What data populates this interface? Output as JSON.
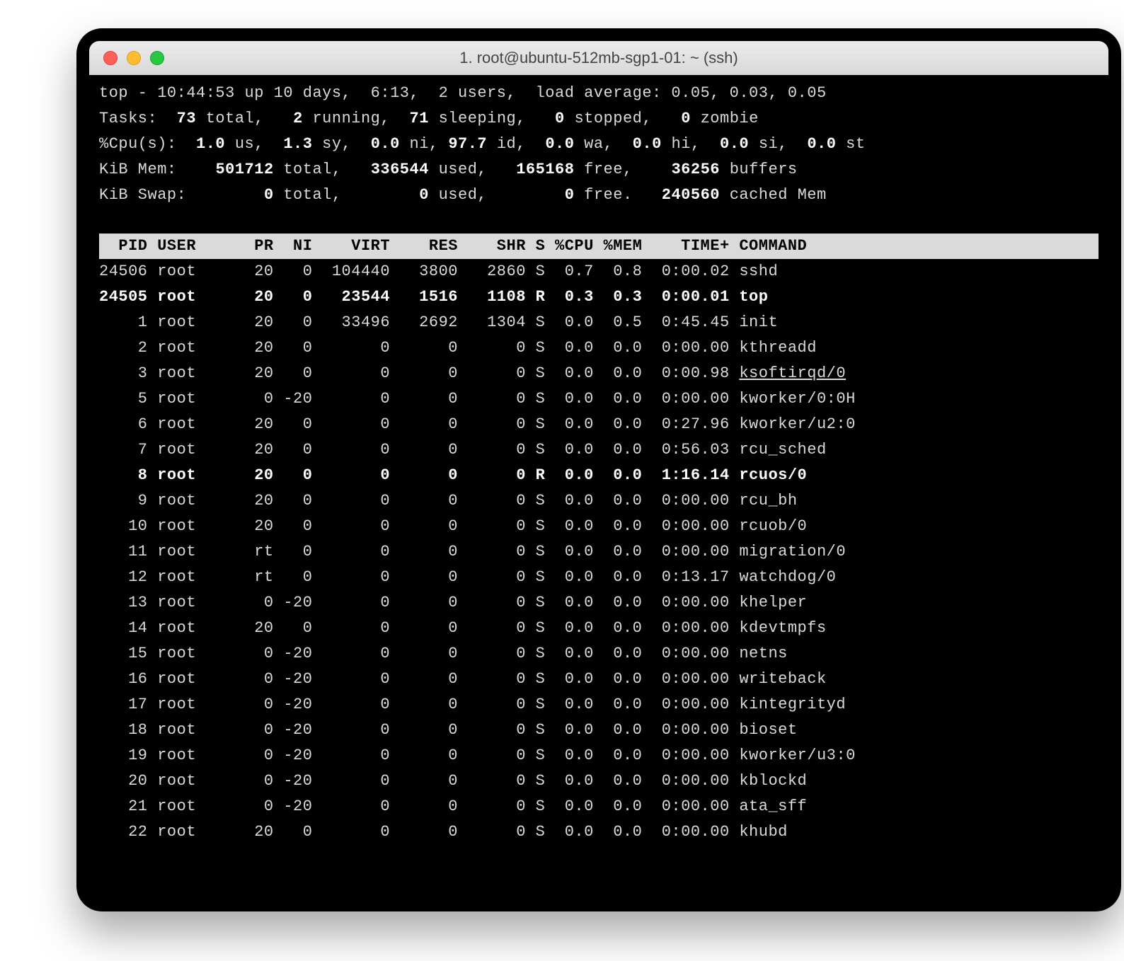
{
  "window": {
    "title": "1. root@ubuntu-512mb-sgp1-01: ~ (ssh)"
  },
  "summary_lines": [
    [
      {
        "t": "top - 10:44:53 up 10 days,  6:13,  2 users,  load average: 0.05, 0.03, 0.05"
      }
    ],
    [
      {
        "t": "Tasks:  "
      },
      {
        "t": "73 ",
        "b": true
      },
      {
        "t": "total,   "
      },
      {
        "t": "2 ",
        "b": true
      },
      {
        "t": "running,  "
      },
      {
        "t": "71 ",
        "b": true
      },
      {
        "t": "sleeping,   "
      },
      {
        "t": "0 ",
        "b": true
      },
      {
        "t": "stopped,   "
      },
      {
        "t": "0 ",
        "b": true
      },
      {
        "t": "zombie"
      }
    ],
    [
      {
        "t": "%Cpu(s):  "
      },
      {
        "t": "1.0 ",
        "b": true
      },
      {
        "t": "us,  "
      },
      {
        "t": "1.3 ",
        "b": true
      },
      {
        "t": "sy,  "
      },
      {
        "t": "0.0 ",
        "b": true
      },
      {
        "t": "ni, "
      },
      {
        "t": "97.7 ",
        "b": true
      },
      {
        "t": "id,  "
      },
      {
        "t": "0.0 ",
        "b": true
      },
      {
        "t": "wa,  "
      },
      {
        "t": "0.0 ",
        "b": true
      },
      {
        "t": "hi,  "
      },
      {
        "t": "0.0 ",
        "b": true
      },
      {
        "t": "si,  "
      },
      {
        "t": "0.0 ",
        "b": true
      },
      {
        "t": "st"
      }
    ],
    [
      {
        "t": "KiB Mem:    "
      },
      {
        "t": "501712 ",
        "b": true
      },
      {
        "t": "total,   "
      },
      {
        "t": "336544 ",
        "b": true
      },
      {
        "t": "used,   "
      },
      {
        "t": "165168 ",
        "b": true
      },
      {
        "t": "free,    "
      },
      {
        "t": "36256 ",
        "b": true
      },
      {
        "t": "buffers"
      }
    ],
    [
      {
        "t": "KiB Swap:        "
      },
      {
        "t": "0 ",
        "b": true
      },
      {
        "t": "total,        "
      },
      {
        "t": "0 ",
        "b": true
      },
      {
        "t": "used,        "
      },
      {
        "t": "0 ",
        "b": true
      },
      {
        "t": "free.   "
      },
      {
        "t": "240560 ",
        "b": true
      },
      {
        "t": "cached Mem"
      }
    ]
  ],
  "columns": [
    "PID",
    "USER",
    "PR",
    "NI",
    "VIRT",
    "RES",
    "SHR",
    "S",
    "%CPU",
    "%MEM",
    "TIME+",
    "COMMAND"
  ],
  "col_widths": {
    "PID": 5,
    "USER": 8,
    "PR": 3,
    "NI": 3,
    "VIRT": 7,
    "RES": 6,
    "SHR": 6,
    "S": 1,
    "%CPU": 4,
    "%MEM": 4,
    "TIME+": 8,
    "COMMAND": 20
  },
  "processes": [
    {
      "PID": "24506",
      "USER": "root",
      "PR": "20",
      "NI": "0",
      "VIRT": "104440",
      "RES": "3800",
      "SHR": "2860",
      "S": "S",
      "%CPU": "0.7",
      "%MEM": "0.8",
      "TIME+": "0:00.02",
      "COMMAND": "sshd"
    },
    {
      "PID": "24505",
      "USER": "root",
      "PR": "20",
      "NI": "0",
      "VIRT": "23544",
      "RES": "1516",
      "SHR": "1108",
      "S": "R",
      "%CPU": "0.3",
      "%MEM": "0.3",
      "TIME+": "0:00.01",
      "COMMAND": "top",
      "bold": true
    },
    {
      "PID": "1",
      "USER": "root",
      "PR": "20",
      "NI": "0",
      "VIRT": "33496",
      "RES": "2692",
      "SHR": "1304",
      "S": "S",
      "%CPU": "0.0",
      "%MEM": "0.5",
      "TIME+": "0:45.45",
      "COMMAND": "init"
    },
    {
      "PID": "2",
      "USER": "root",
      "PR": "20",
      "NI": "0",
      "VIRT": "0",
      "RES": "0",
      "SHR": "0",
      "S": "S",
      "%CPU": "0.0",
      "%MEM": "0.0",
      "TIME+": "0:00.00",
      "COMMAND": "kthreadd"
    },
    {
      "PID": "3",
      "USER": "root",
      "PR": "20",
      "NI": "0",
      "VIRT": "0",
      "RES": "0",
      "SHR": "0",
      "S": "S",
      "%CPU": "0.0",
      "%MEM": "0.0",
      "TIME+": "0:00.98",
      "COMMAND": "ksoftirqd/0",
      "underline": true
    },
    {
      "PID": "5",
      "USER": "root",
      "PR": "0",
      "NI": "-20",
      "VIRT": "0",
      "RES": "0",
      "SHR": "0",
      "S": "S",
      "%CPU": "0.0",
      "%MEM": "0.0",
      "TIME+": "0:00.00",
      "COMMAND": "kworker/0:0H"
    },
    {
      "PID": "6",
      "USER": "root",
      "PR": "20",
      "NI": "0",
      "VIRT": "0",
      "RES": "0",
      "SHR": "0",
      "S": "S",
      "%CPU": "0.0",
      "%MEM": "0.0",
      "TIME+": "0:27.96",
      "COMMAND": "kworker/u2:0"
    },
    {
      "PID": "7",
      "USER": "root",
      "PR": "20",
      "NI": "0",
      "VIRT": "0",
      "RES": "0",
      "SHR": "0",
      "S": "S",
      "%CPU": "0.0",
      "%MEM": "0.0",
      "TIME+": "0:56.03",
      "COMMAND": "rcu_sched"
    },
    {
      "PID": "8",
      "USER": "root",
      "PR": "20",
      "NI": "0",
      "VIRT": "0",
      "RES": "0",
      "SHR": "0",
      "S": "R",
      "%CPU": "0.0",
      "%MEM": "0.0",
      "TIME+": "1:16.14",
      "COMMAND": "rcuos/0",
      "bold": true
    },
    {
      "PID": "9",
      "USER": "root",
      "PR": "20",
      "NI": "0",
      "VIRT": "0",
      "RES": "0",
      "SHR": "0",
      "S": "S",
      "%CPU": "0.0",
      "%MEM": "0.0",
      "TIME+": "0:00.00",
      "COMMAND": "rcu_bh"
    },
    {
      "PID": "10",
      "USER": "root",
      "PR": "20",
      "NI": "0",
      "VIRT": "0",
      "RES": "0",
      "SHR": "0",
      "S": "S",
      "%CPU": "0.0",
      "%MEM": "0.0",
      "TIME+": "0:00.00",
      "COMMAND": "rcuob/0"
    },
    {
      "PID": "11",
      "USER": "root",
      "PR": "rt",
      "NI": "0",
      "VIRT": "0",
      "RES": "0",
      "SHR": "0",
      "S": "S",
      "%CPU": "0.0",
      "%MEM": "0.0",
      "TIME+": "0:00.00",
      "COMMAND": "migration/0"
    },
    {
      "PID": "12",
      "USER": "root",
      "PR": "rt",
      "NI": "0",
      "VIRT": "0",
      "RES": "0",
      "SHR": "0",
      "S": "S",
      "%CPU": "0.0",
      "%MEM": "0.0",
      "TIME+": "0:13.17",
      "COMMAND": "watchdog/0"
    },
    {
      "PID": "13",
      "USER": "root",
      "PR": "0",
      "NI": "-20",
      "VIRT": "0",
      "RES": "0",
      "SHR": "0",
      "S": "S",
      "%CPU": "0.0",
      "%MEM": "0.0",
      "TIME+": "0:00.00",
      "COMMAND": "khelper"
    },
    {
      "PID": "14",
      "USER": "root",
      "PR": "20",
      "NI": "0",
      "VIRT": "0",
      "RES": "0",
      "SHR": "0",
      "S": "S",
      "%CPU": "0.0",
      "%MEM": "0.0",
      "TIME+": "0:00.00",
      "COMMAND": "kdevtmpfs"
    },
    {
      "PID": "15",
      "USER": "root",
      "PR": "0",
      "NI": "-20",
      "VIRT": "0",
      "RES": "0",
      "SHR": "0",
      "S": "S",
      "%CPU": "0.0",
      "%MEM": "0.0",
      "TIME+": "0:00.00",
      "COMMAND": "netns"
    },
    {
      "PID": "16",
      "USER": "root",
      "PR": "0",
      "NI": "-20",
      "VIRT": "0",
      "RES": "0",
      "SHR": "0",
      "S": "S",
      "%CPU": "0.0",
      "%MEM": "0.0",
      "TIME+": "0:00.00",
      "COMMAND": "writeback"
    },
    {
      "PID": "17",
      "USER": "root",
      "PR": "0",
      "NI": "-20",
      "VIRT": "0",
      "RES": "0",
      "SHR": "0",
      "S": "S",
      "%CPU": "0.0",
      "%MEM": "0.0",
      "TIME+": "0:00.00",
      "COMMAND": "kintegrityd"
    },
    {
      "PID": "18",
      "USER": "root",
      "PR": "0",
      "NI": "-20",
      "VIRT": "0",
      "RES": "0",
      "SHR": "0",
      "S": "S",
      "%CPU": "0.0",
      "%MEM": "0.0",
      "TIME+": "0:00.00",
      "COMMAND": "bioset"
    },
    {
      "PID": "19",
      "USER": "root",
      "PR": "0",
      "NI": "-20",
      "VIRT": "0",
      "RES": "0",
      "SHR": "0",
      "S": "S",
      "%CPU": "0.0",
      "%MEM": "0.0",
      "TIME+": "0:00.00",
      "COMMAND": "kworker/u3:0"
    },
    {
      "PID": "20",
      "USER": "root",
      "PR": "0",
      "NI": "-20",
      "VIRT": "0",
      "RES": "0",
      "SHR": "0",
      "S": "S",
      "%CPU": "0.0",
      "%MEM": "0.0",
      "TIME+": "0:00.00",
      "COMMAND": "kblockd"
    },
    {
      "PID": "21",
      "USER": "root",
      "PR": "0",
      "NI": "-20",
      "VIRT": "0",
      "RES": "0",
      "SHR": "0",
      "S": "S",
      "%CPU": "0.0",
      "%MEM": "0.0",
      "TIME+": "0:00.00",
      "COMMAND": "ata_sff"
    },
    {
      "PID": "22",
      "USER": "root",
      "PR": "20",
      "NI": "0",
      "VIRT": "0",
      "RES": "0",
      "SHR": "0",
      "S": "S",
      "%CPU": "0.0",
      "%MEM": "0.0",
      "TIME+": "0:00.00",
      "COMMAND": "khubd"
    }
  ]
}
